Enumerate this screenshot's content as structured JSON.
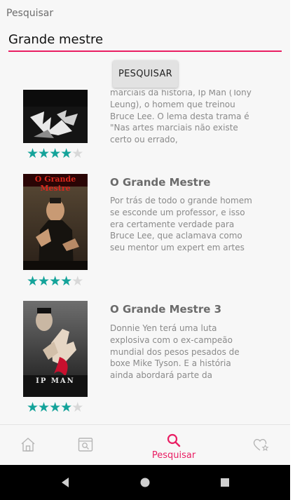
{
  "app": {
    "title": "Pesquisar"
  },
  "search": {
    "value": "Grande mestre",
    "button_label": "PESQUISAR"
  },
  "movies": [
    {
      "title": "",
      "description": "marciais da história, Ip Man (Tony Leung), o homem que treinou Bruce Lee. O lema desta trama é \"Nas artes marciais não existe certo ou errado,",
      "rating": 4,
      "rating_max": 5
    },
    {
      "title": "O Grande Mestre",
      "poster_text": "O Grande Mestre",
      "description": "Por trás de todo o grande homem se esconde um professor, e isso era certamente verdade para Bruce Lee, que aclamava como seu mentor um expert em artes marciais chamado Ip Man. Um gênio do Wushu (a escola",
      "rating": 4,
      "rating_max": 5
    },
    {
      "title": "O Grande Mestre 3",
      "poster_text": "IP MAN",
      "description": "Donnie Yen terá uma luta explosiva com o ex-campeão mundial dos pesos pesados de boxe Mike Tyson. E a história ainda abordará parte da juventude do maior discípulo de Yip Man: Bruce Lee.",
      "rating": 4,
      "rating_max": 5
    }
  ],
  "bottom_nav": {
    "items": [
      {
        "icon": "home-icon",
        "label": ""
      },
      {
        "icon": "gallery-icon",
        "label": ""
      },
      {
        "icon": "search-icon",
        "label": "Pesquisar",
        "active": true
      },
      {
        "icon": "heart-star-icon",
        "label": ""
      }
    ]
  },
  "colors": {
    "accent": "#e91e63",
    "star": "#14a39a",
    "star_empty": "#d8d8d8",
    "background": "#f7f7f7"
  }
}
